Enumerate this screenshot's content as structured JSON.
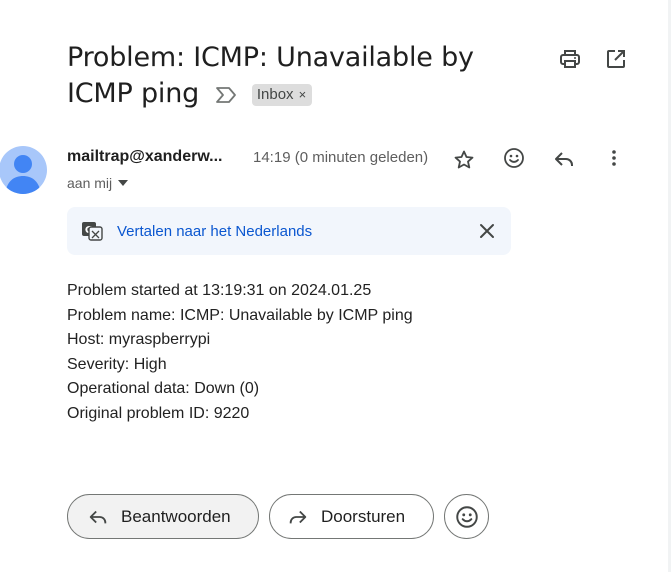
{
  "email": {
    "subject": "Problem: ICMP: Unavailable by ICMP ping",
    "label_chip": "Inbox",
    "label_remove": "×",
    "sender": "mailtrap@xanderw...",
    "time": "14:19 (0 minuten geleden)",
    "recipient": "aan mij"
  },
  "translate": {
    "link": "Vertalen naar het Nederlands"
  },
  "body_lines": [
    "Problem started at 13:19:31 on 2024.01.25",
    "Problem name: ICMP: Unavailable by ICMP ping",
    "Host: myraspberrypi",
    "Severity: High",
    "Operational data: Down (0)",
    "Original problem ID: 9220"
  ],
  "actions": {
    "reply": "Beantwoorden",
    "forward": "Doorsturen"
  },
  "icons": {
    "print": "print-icon",
    "open_new_window": "open-in-new-window-icon",
    "importance": "importance-marker-icon",
    "star": "star-icon",
    "emoji": "add-reaction-icon",
    "reply": "reply-icon",
    "more": "more-vertical-icon",
    "translate": "translate-icon",
    "close": "close-icon",
    "forward": "forward-icon",
    "avatar": "default-avatar-icon"
  },
  "colors": {
    "link": "#0b57d0",
    "avatar_bg": "#a8c7fa",
    "avatar_fg": "#4285f4",
    "translate_bg": "#f2f6fc"
  }
}
